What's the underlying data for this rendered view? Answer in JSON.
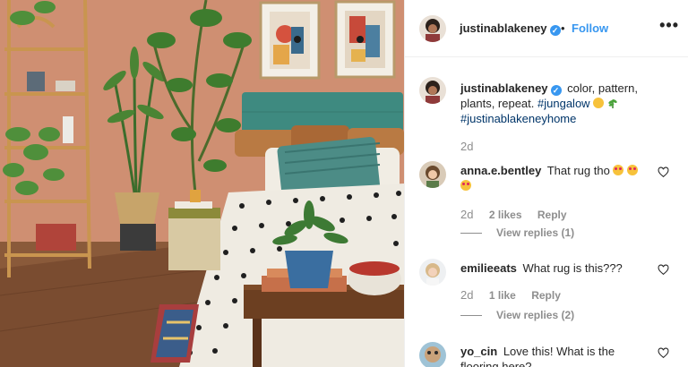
{
  "post": {
    "author": "justinablakeney",
    "follow_label": "Follow",
    "more_label": "•••",
    "separator": "•",
    "verified_mark": "✓"
  },
  "caption": {
    "user": "justinablakeney",
    "text": "color, pattern, plants, repeat.",
    "hashtags": [
      "#jungalow",
      "#justinablakeneyhome"
    ],
    "emoji": [
      "smiling-face-emoji",
      "herb-emoji"
    ],
    "time": "2d"
  },
  "comments": [
    {
      "user": "anna.e.bentley",
      "text": "That rug tho",
      "emoji": [
        "heart-eyes-emoji",
        "heart-eyes-emoji",
        "heart-eyes-emoji"
      ],
      "time": "2d",
      "likes": "2 likes",
      "reply": "Reply",
      "view_replies": "View replies (1)"
    },
    {
      "user": "emilieeats",
      "text": "What rug is this???",
      "time": "2d",
      "likes": "1 like",
      "reply": "Reply",
      "view_replies": "View replies (2)"
    },
    {
      "user": "yo_cin",
      "text": "Love this! What is the flooring here?"
    }
  ],
  "colors": {
    "link_blue": "#3897f0",
    "hashtag_navy": "#003569",
    "muted_gray": "#8e8e8e",
    "wall_terracotta": "#c98a6e",
    "headboard_teal": "#3e8a80"
  }
}
